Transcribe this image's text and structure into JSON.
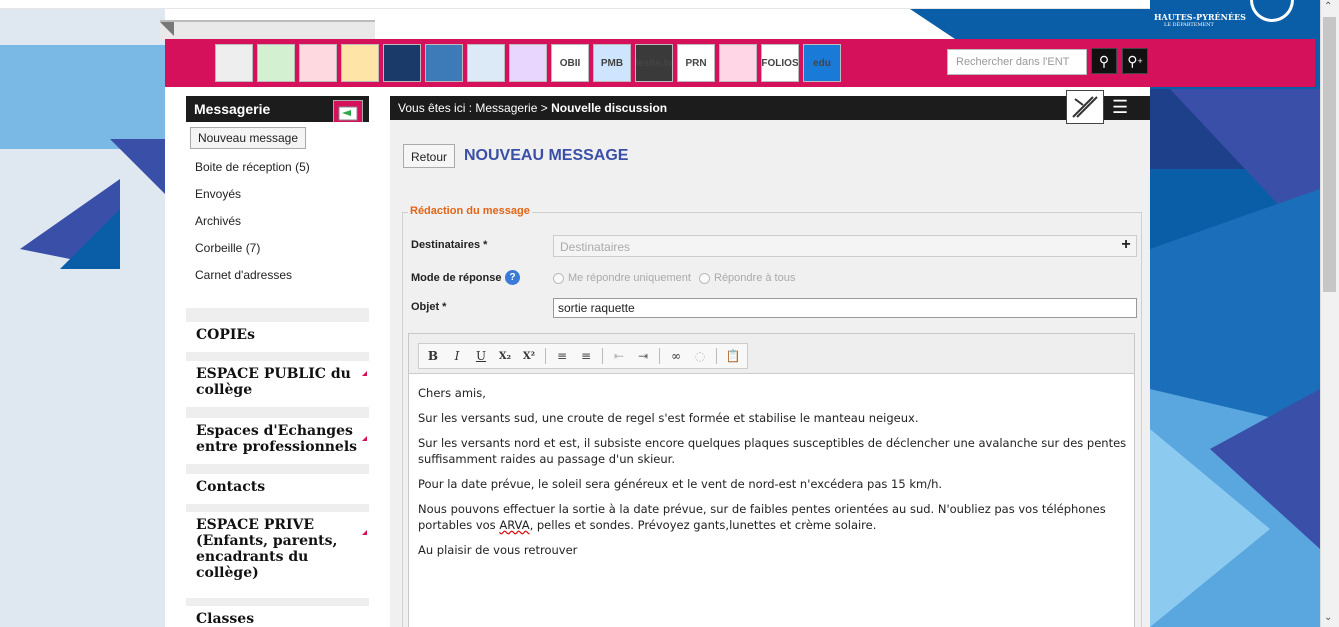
{
  "header": {
    "search_placeholder": "Rechercher dans l'ENT",
    "search_icon": "search-icon",
    "advanced_search_icon": "search-plus-icon",
    "logo_text": "HAUTES-PYRÉNÉES",
    "logo_subtext": "LE DÉPARTEMENT",
    "app_icons": [
      {
        "name": "tasks-app-icon",
        "text": ""
      },
      {
        "name": "messaging-app-icon",
        "text": ""
      },
      {
        "name": "calendar-app-icon",
        "text": ""
      },
      {
        "name": "folders-app-icon",
        "text": ""
      },
      {
        "name": "screen-app-icon",
        "text": ""
      },
      {
        "name": "book-app-icon",
        "text": ""
      },
      {
        "name": "profile-app-icon",
        "text": ""
      },
      {
        "name": "help-app-icon",
        "text": ""
      },
      {
        "name": "obii-app-icon",
        "text": "OBII"
      },
      {
        "name": "pmb-app-icon",
        "text": "PMB"
      },
      {
        "name": "lesite-tv-app-icon",
        "text": "lesite.tv"
      },
      {
        "name": "prn-app-icon",
        "text": "PRN"
      },
      {
        "name": "news-app-icon",
        "text": ""
      },
      {
        "name": "folios-app-icon",
        "text": "FOLIOS"
      },
      {
        "name": "edu-app-icon",
        "text": "edu"
      }
    ]
  },
  "sidebar": {
    "title": "Messagerie",
    "new_message_label": "Nouveau message",
    "links": [
      "Boite de réception (5)",
      "Envoyés",
      "Archivés",
      "Corbeille (7)",
      "Carnet d'adresses"
    ],
    "sections": [
      "COPIEs",
      "ESPACE PUBLIC du collège",
      "Espaces d'Echanges entre professionnels",
      "Contacts",
      "ESPACE PRIVE (Enfants, parents, encadrants du collège)",
      "Classes"
    ]
  },
  "main": {
    "breadcrumb_prefix": "Vous êtes ici : Messagerie > ",
    "breadcrumb_current": "Nouvelle discussion",
    "back_label": "Retour",
    "title": "NOUVEAU MESSAGE",
    "legend": "Rédaction du message",
    "recipients_label": "Destinataires *",
    "recipients_placeholder": "Destinataires",
    "reply_mode_label": "Mode de réponse",
    "reply_option_1": "Me répondre uniquement",
    "reply_option_2": "Répondre à tous",
    "subject_label": "Objet *",
    "subject_value": "sortie raquette"
  },
  "editor": {
    "toolbar": [
      "B",
      "I",
      "U",
      "X₂",
      "X²"
    ],
    "p1": "Chers amis,",
    "p2": "Sur les versants sud, une croute de regel s'est formée et stabilise le manteau neigeux.",
    "p3": "Sur les versants nord et est, il subsiste encore quelques plaques susceptibles de déclencher une avalanche sur des pentes suffisamment raides au passage d'un skieur.",
    "p4": "Pour la date prévue, le soleil sera généreux et le vent de nord-est n'excédera pas 15 km/h.",
    "p5_a": "Nous pouvons effectuer la sortie à la date prévue, sur de faibles pentes orientées au sud. N'oubliez pas vos téléphones portables vos ",
    "p5_arva": "ARVA",
    "p5_b": ", pelles et sondes. Prévoyez gants,lunettes et crème solaire.",
    "p6": "Au plaisir de vous retrouver"
  },
  "colors": {
    "accent": "#d6115c",
    "title": "#3a4fa8",
    "legend": "#e36414",
    "right_panel": "#0a5ea8"
  }
}
